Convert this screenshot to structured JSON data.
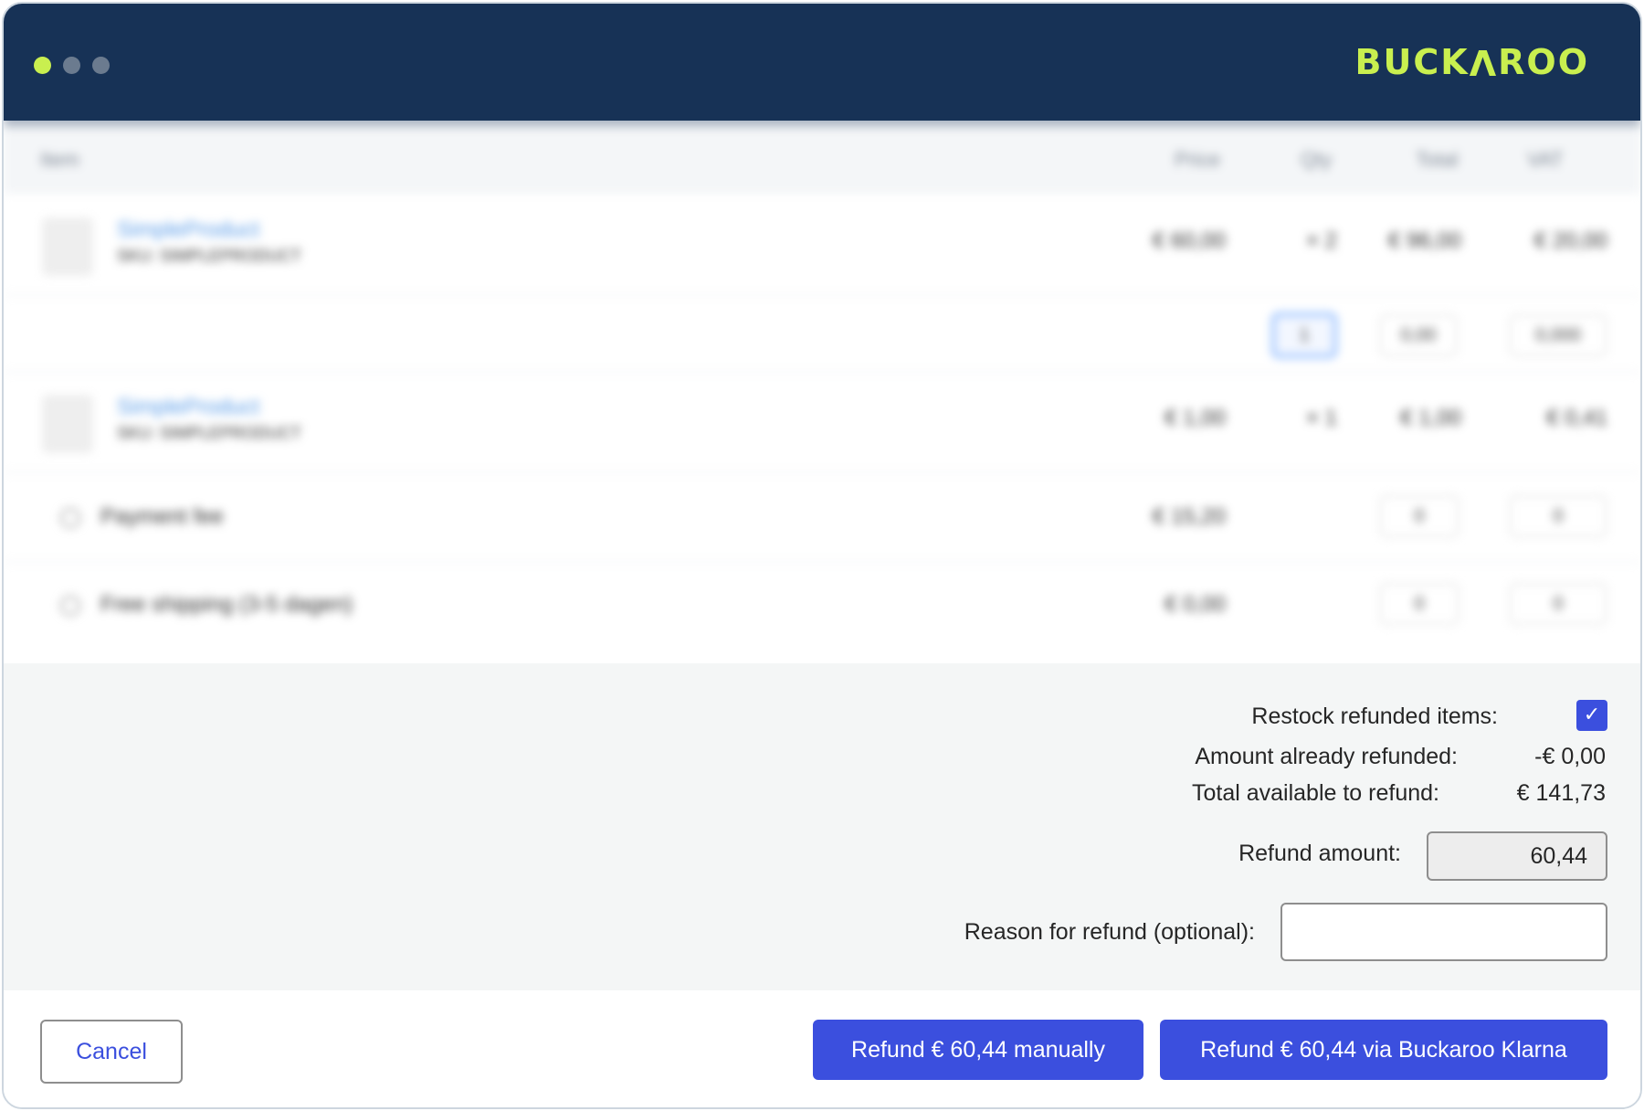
{
  "titlebar": {
    "logo_parts": [
      "BUCK",
      "V",
      "ROO"
    ],
    "accent_color": "#c9ef4f",
    "background_color": "#173256"
  },
  "table": {
    "headers": [
      "Item",
      "Price",
      "Qty",
      "Total",
      "VAT"
    ],
    "rows": [
      {
        "name": "SimpleProduct",
        "sku": "SKU: SIMPLEPRODUCT",
        "price": "€ 60,00",
        "qty": "× 2",
        "total": "€ 96,00",
        "vat": "€ 20,00"
      },
      {
        "name": "SimpleProduct",
        "sku": "SKU: SIMPLEPRODUCT",
        "price": "€ 1,00",
        "qty": "× 1",
        "total": "€ 1,00",
        "vat": "€ 0,41"
      }
    ],
    "refund_row": {
      "qty": "1",
      "total": "0,00",
      "vat": "0,000"
    },
    "fees": [
      {
        "label": "Payment fee",
        "price": "€ 15,20",
        "total": "0",
        "vat": "0"
      },
      {
        "label": "Free shipping (3-5 dagen)",
        "price": "€ 0,00",
        "total": "0",
        "vat": "0"
      }
    ]
  },
  "form": {
    "restock_label": "Restock refunded items:",
    "restock_checked": true,
    "already_refunded_label": "Amount already refunded:",
    "already_refunded_value": "-€ 0,00",
    "available_label": "Total available to refund:",
    "available_value": "€ 141,73",
    "refund_amount_label": "Refund amount:",
    "refund_amount_value": "60,44",
    "reason_label": "Reason for refund (optional):",
    "reason_value": ""
  },
  "footer": {
    "cancel_label": "Cancel",
    "refund_manual_label": "Refund € 60,44 manually",
    "refund_gateway_label": "Refund € 60,44 via Buckaroo Klarna",
    "primary_color": "#3b4fde"
  }
}
